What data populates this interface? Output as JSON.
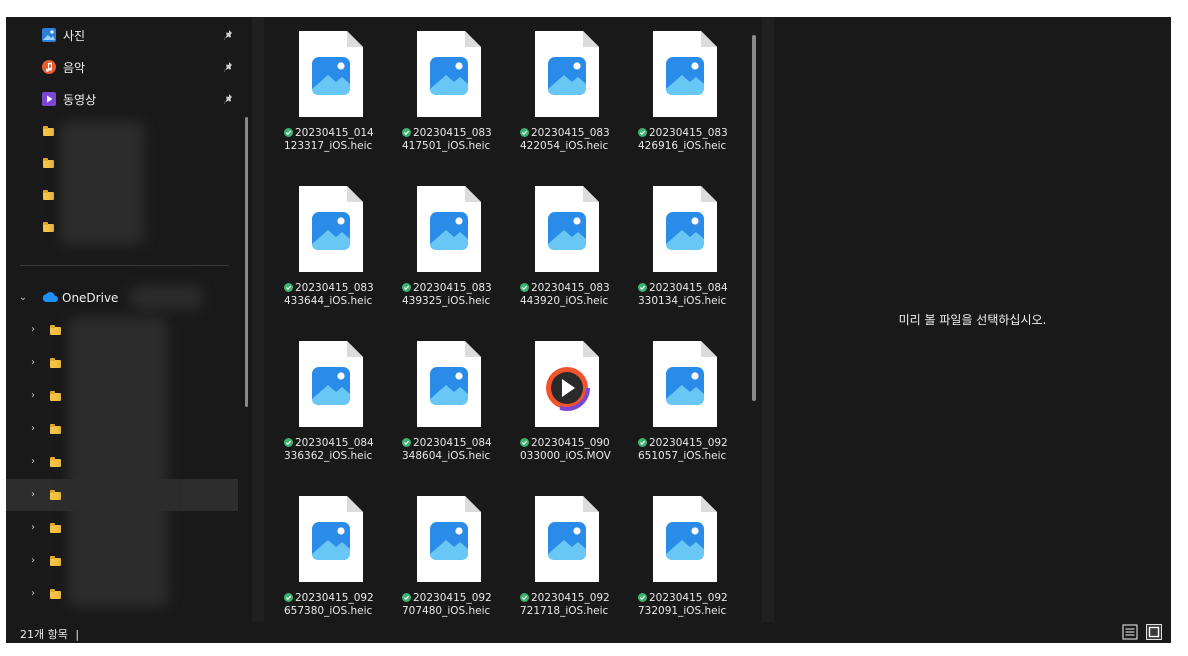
{
  "nav": {
    "quick_access": [
      {
        "label": "사진",
        "icon": "photos-icon",
        "color": "#3a8ee6"
      },
      {
        "label": "음악",
        "icon": "music-icon",
        "color": "#e85d30"
      },
      {
        "label": "동영상",
        "icon": "video-icon",
        "color": "#8a56d8"
      }
    ],
    "onedrive_label": "OneDrive"
  },
  "files": [
    {
      "name": "20230415_014123317_iOS.heic",
      "type": "image"
    },
    {
      "name": "20230415_083417501_iOS.heic",
      "type": "image"
    },
    {
      "name": "20230415_083422054_iOS.heic",
      "type": "image"
    },
    {
      "name": "20230415_083426916_iOS.heic",
      "type": "image"
    },
    {
      "name": "20230415_083433644_iOS.heic",
      "type": "image"
    },
    {
      "name": "20230415_083439325_iOS.heic",
      "type": "image"
    },
    {
      "name": "20230415_083443920_iOS.heic",
      "type": "image"
    },
    {
      "name": "20230415_084330134_iOS.heic",
      "type": "image"
    },
    {
      "name": "20230415_084336362_iOS.heic",
      "type": "image"
    },
    {
      "name": "20230415_084348604_iOS.heic",
      "type": "image"
    },
    {
      "name": "20230415_090033000_iOS.MOV",
      "type": "video"
    },
    {
      "name": "20230415_092651057_iOS.heic",
      "type": "image"
    },
    {
      "name": "20230415_092657380_iOS.heic",
      "type": "image"
    },
    {
      "name": "20230415_092707480_iOS.heic",
      "type": "image"
    },
    {
      "name": "20230415_092721718_iOS.heic",
      "type": "image"
    },
    {
      "name": "20230415_092732091_iOS.heic",
      "type": "image"
    }
  ],
  "preview": {
    "message": "미리 볼 파일을 선택하십시오."
  },
  "status": {
    "item_count": "21개 항목",
    "cursor": "|"
  },
  "colors": {
    "accent": "#3a8ee6",
    "sync_green": "#3cb371",
    "folder": "#f6c445",
    "background": "#191919"
  }
}
